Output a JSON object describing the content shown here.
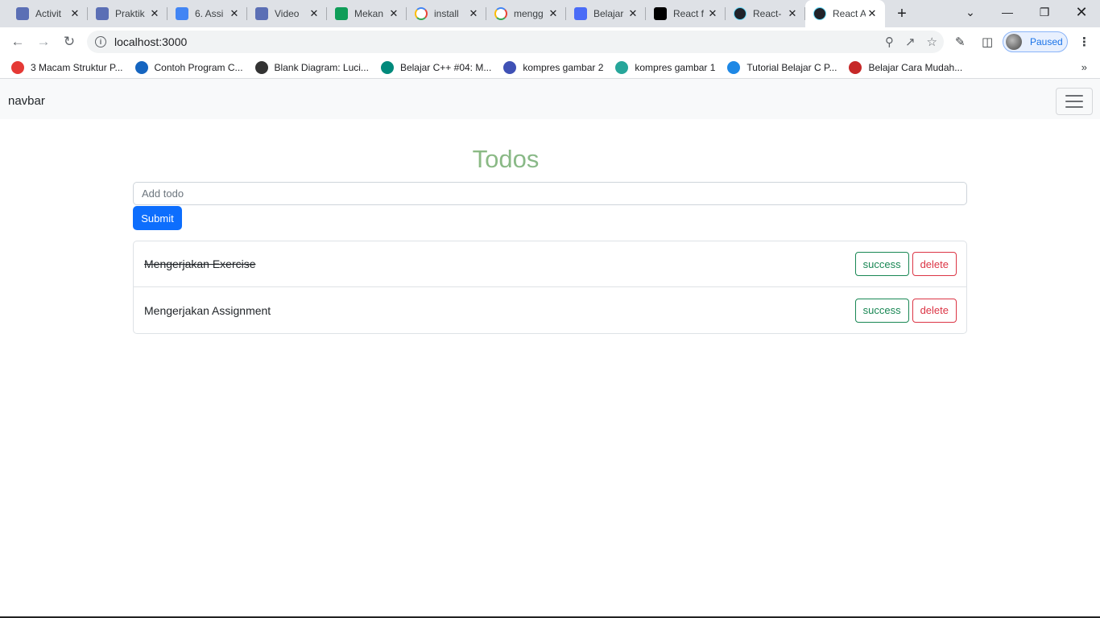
{
  "browser": {
    "tabs": [
      {
        "title": "Activit",
        "icon": "site-icon",
        "color": "#5b6fb5"
      },
      {
        "title": "Praktik",
        "icon": "site-icon",
        "color": "#5b6fb5"
      },
      {
        "title": "6. Assi",
        "icon": "docs-icon",
        "color": "#4285f4"
      },
      {
        "title": "Video",
        "icon": "site-icon",
        "color": "#5b6fb5"
      },
      {
        "title": "Mekan",
        "icon": "sheets-icon",
        "color": "#0f9d58"
      },
      {
        "title": "install",
        "icon": "google-icon",
        "color": "#ffffff"
      },
      {
        "title": "mengg",
        "icon": "google-icon",
        "color": "#ffffff"
      },
      {
        "title": "Belajar",
        "icon": "wave-icon",
        "color": "#4a6cf7"
      },
      {
        "title": "React f",
        "icon": "medium-icon",
        "color": "#000000"
      },
      {
        "title": "React-",
        "icon": "react-icon",
        "color": "#20232a"
      },
      {
        "title": "React A",
        "icon": "react-icon",
        "color": "#20232a",
        "active": true
      }
    ],
    "new_tab": "+",
    "url": "localhost:3000",
    "profile_label": "Paused",
    "bookmarks": [
      {
        "label": "3 Macam Struktur P...",
        "icon": "md-icon",
        "color": "#e53935"
      },
      {
        "label": "Contoh Program C...",
        "icon": "k-icon",
        "color": "#1565c0"
      },
      {
        "label": "Blank Diagram: Luci...",
        "icon": "lucid-icon",
        "color": "#333333"
      },
      {
        "label": "Belajar C++ #04: M...",
        "icon": "petani-icon",
        "color": "#00897b"
      },
      {
        "label": "kompres gambar 2",
        "icon": "compress-icon",
        "color": "#3f51b5"
      },
      {
        "label": "kompres gambar 1",
        "icon": "leaf-icon",
        "color": "#26a69a"
      },
      {
        "label": "Tutorial Belajar C P...",
        "icon": "di-icon",
        "color": "#1e88e5"
      },
      {
        "label": "Belajar Cara Mudah...",
        "icon": "flag-icon",
        "color": "#c62828"
      }
    ]
  },
  "navbar": {
    "brand": "navbar"
  },
  "main": {
    "title": "Todos",
    "input_placeholder": "Add todo",
    "submit_label": "Submit",
    "todos": [
      {
        "text": "Mengerjakan Exercise",
        "done": true,
        "success_label": "success",
        "delete_label": "delete"
      },
      {
        "text": "Mengerjakan Assignment",
        "done": false,
        "success_label": "success",
        "delete_label": "delete"
      }
    ]
  }
}
